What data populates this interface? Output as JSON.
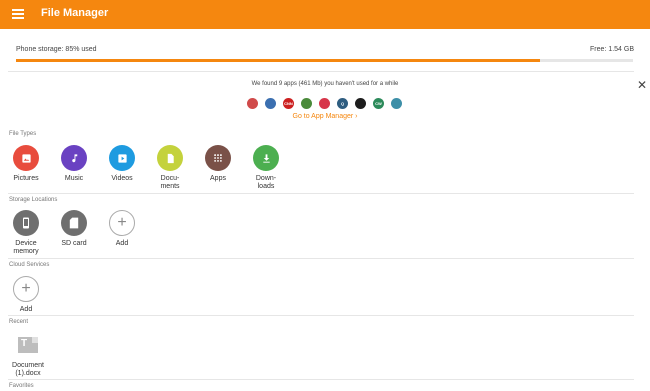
{
  "app": {
    "title": "File Manager"
  },
  "storage": {
    "label": "Phone storage: 85% used",
    "free": "Free: 1.54 GB",
    "used_fraction": 0.85
  },
  "notice": {
    "text": "We found 9 apps (461 Mb) you haven't used for a while",
    "link": "Go to App Manager ›",
    "apps": [
      {
        "icon": "flag-app-icon",
        "color": "#d04a4a",
        "glyph": ""
      },
      {
        "icon": "chrome-like-app-icon",
        "color": "#3b6fb0",
        "glyph": ""
      },
      {
        "icon": "cnn-app-icon",
        "color": "#cc1f1f",
        "glyph": "CNN"
      },
      {
        "icon": "game-app-icon",
        "color": "#4a8a3a",
        "glyph": ""
      },
      {
        "icon": "pocket-app-icon",
        "color": "#d7354a",
        "glyph": ""
      },
      {
        "icon": "q-app-icon",
        "color": "#2e5d80",
        "glyph": "Q"
      },
      {
        "icon": "nbc-app-icon",
        "color": "#1d1d1d",
        "glyph": ""
      },
      {
        "icon": "cw-app-icon",
        "color": "#2c8a5a",
        "glyph": "CW"
      },
      {
        "icon": "globe-app-icon",
        "color": "#3d8fa8",
        "glyph": ""
      }
    ]
  },
  "sections": {
    "file_types": "File Types",
    "storage_locations": "Storage Locations",
    "cloud_services": "Cloud Services",
    "recent": "Recent",
    "favorites": "Favorites"
  },
  "file_types": [
    {
      "label": "Pictures",
      "color": "#E84C3D",
      "icon": "image-icon"
    },
    {
      "label": "Music",
      "color": "#6A42C2",
      "icon": "music-note-icon"
    },
    {
      "label": "Videos",
      "color": "#1E9BE0",
      "icon": "play-icon"
    },
    {
      "label": "Docu-\nments",
      "color": "#C4D23C",
      "icon": "document-icon"
    },
    {
      "label": "Apps",
      "color": "#7A5148",
      "icon": "grid-icon"
    },
    {
      "label": "Down-\nloads",
      "color": "#4CAF50",
      "icon": "download-icon"
    }
  ],
  "storage_locations": [
    {
      "label": "Device\nmemory",
      "icon": "phone-icon"
    },
    {
      "label": "SD card",
      "icon": "sd-card-icon"
    },
    {
      "label": "Add",
      "icon": "plus-icon"
    }
  ],
  "cloud_services": [
    {
      "label": "Add",
      "icon": "plus-icon"
    }
  ],
  "recent": [
    {
      "label": "Document\n(1).docx",
      "icon": "docx-file-icon"
    }
  ]
}
